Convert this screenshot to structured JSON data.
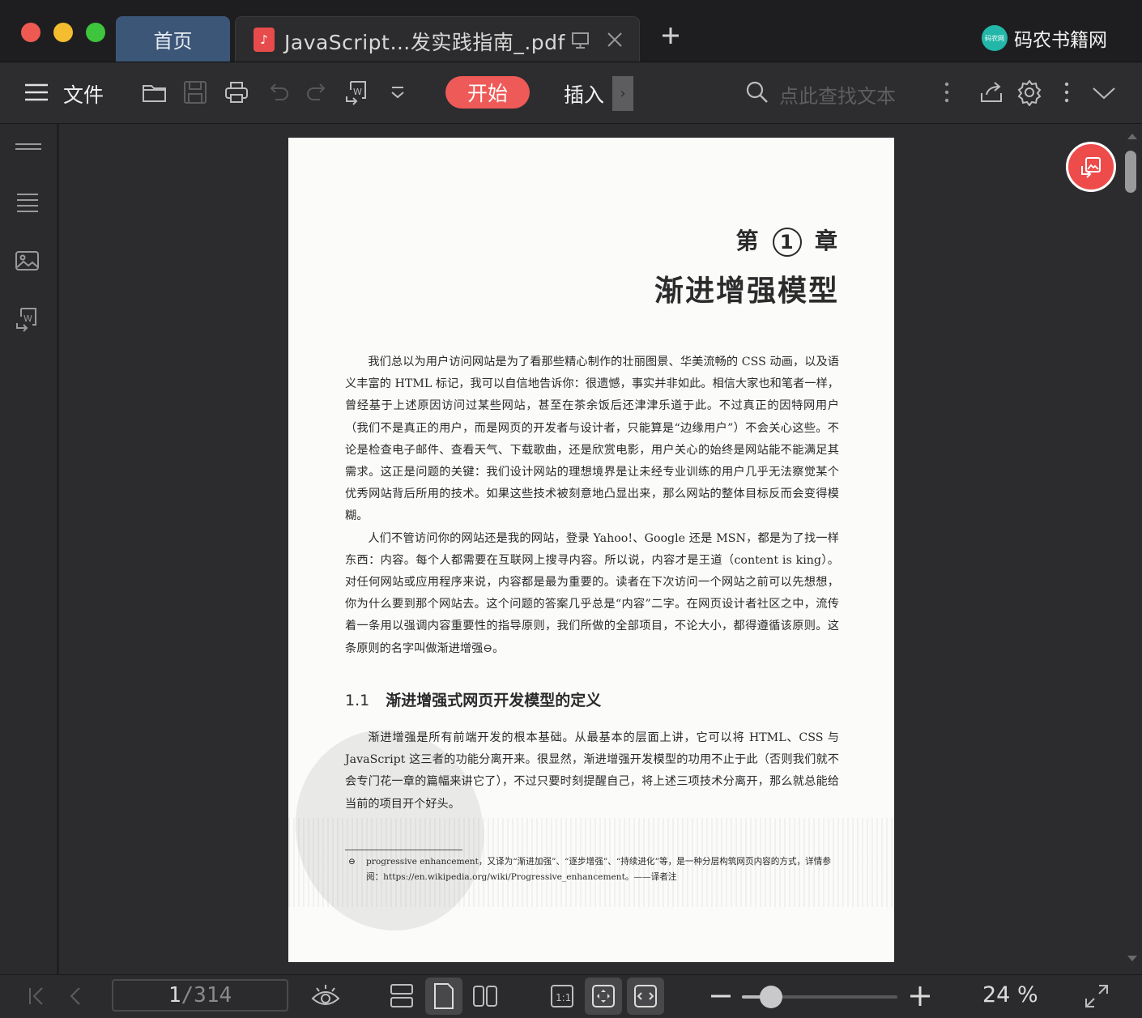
{
  "window": {
    "tabs": [
      {
        "label": "首页"
      },
      {
        "label": "JavaScript…发实践指南_.pdf"
      }
    ],
    "brand": "码农书籍网",
    "brand_logo_text": "码农网"
  },
  "toolbar": {
    "menu_label": "文件",
    "start_label": "开始",
    "insert_label": "插入",
    "search_placeholder": "点此查找文本"
  },
  "document": {
    "chapter_prefix": "第",
    "chapter_number": "1",
    "chapter_suffix": "章",
    "chapter_title": "渐进增强模型",
    "paragraphs": [
      "我们总以为用户访问网站是为了看那些精心制作的壮丽图景、华美流畅的 CSS 动画，以及语义丰富的 HTML 标记，我可以自信地告诉你：很遗憾，事实并非如此。相信大家也和笔者一样，曾经基于上述原因访问过某些网站，甚至在茶余饭后还津津乐道于此。不过真正的因特网用户（我们不是真正的用户，而是网页的开发者与设计者，只能算是“边缘用户”）不会关心这些。不论是检查电子邮件、查看天气、下载歌曲，还是欣赏电影，用户关心的始终是网站能不能满足其需求。这正是问题的关键：我们设计网站的理想境界是让未经专业训练的用户几乎无法察觉某个优秀网站背后所用的技术。如果这些技术被刻意地凸显出来，那么网站的整体目标反而会变得模糊。",
      "人们不管访问你的网站还是我的网站，登录 Yahoo!、Google 还是 MSN，都是为了找一样东西：内容。每个人都需要在互联网上搜寻内容。所以说，内容才是王道（content is king）。对任何网站或应用程序来说，内容都是最为重要的。读者在下次访问一个网站之前可以先想想，你为什么要到那个网站去。这个问题的答案几乎总是“内容”二字。在网页设计者社区之中，流传着一条用以强调内容重要性的指导原则，我们所做的全部项目，不论大小，都得遵循该原则。这条原则的名字叫做渐进增强⊖。"
    ],
    "section_number": "1.1",
    "section_title": "渐进增强式网页开发模型的定义",
    "section_paragraph": "渐进增强是所有前端开发的根本基础。从最基本的层面上讲，它可以将 HTML、CSS 与 JavaScript 这三者的功能分离开来。很显然，渐进增强开发模型的功用不止于此（否则我们就不会专门花一章的篇幅来讲它了），不过只要时刻提醒自己，将上述三项技术分离开，那么就总能给当前的项目开个好头。",
    "footnote_marker": "⊖",
    "footnote": "progressive enhancement，又译为“渐进加强”、“逐步增强”、“持续进化”等，是一种分层构筑网页内容的方式，详情参阅：https://en.wikipedia.org/wiki/Progressive_enhancement。——译者注"
  },
  "statusbar": {
    "current_page": "1",
    "total_pages": "/314",
    "zoom": "24 %",
    "zoom_level_percent": 24
  },
  "colors": {
    "accent": "#ee5a57",
    "home_tab": "#3c5677",
    "brand_logo": "#22b7a8"
  },
  "icons": [
    "close-window-icon",
    "minimize-window-icon",
    "maximize-window-icon",
    "pdf-file-icon",
    "present-icon",
    "close-tab-icon",
    "new-tab-icon",
    "hamburger-menu-icon",
    "open-folder-icon",
    "save-icon",
    "print-icon",
    "undo-icon",
    "redo-icon",
    "pdf-to-word-icon",
    "chevron-down-icon",
    "search-icon",
    "more-vertical-icon",
    "share-icon",
    "settings-icon",
    "collapse-icon",
    "thumbnails-icon",
    "outline-icon",
    "image-icon",
    "convert-icon",
    "pdf-to-image-icon",
    "first-page-icon",
    "prev-page-icon",
    "eye-protection-icon",
    "continuous-scroll-icon",
    "single-page-icon",
    "double-page-icon",
    "actual-size-icon",
    "fit-page-icon",
    "fit-width-icon",
    "zoom-out-icon",
    "zoom-in-icon",
    "fullscreen-icon"
  ]
}
